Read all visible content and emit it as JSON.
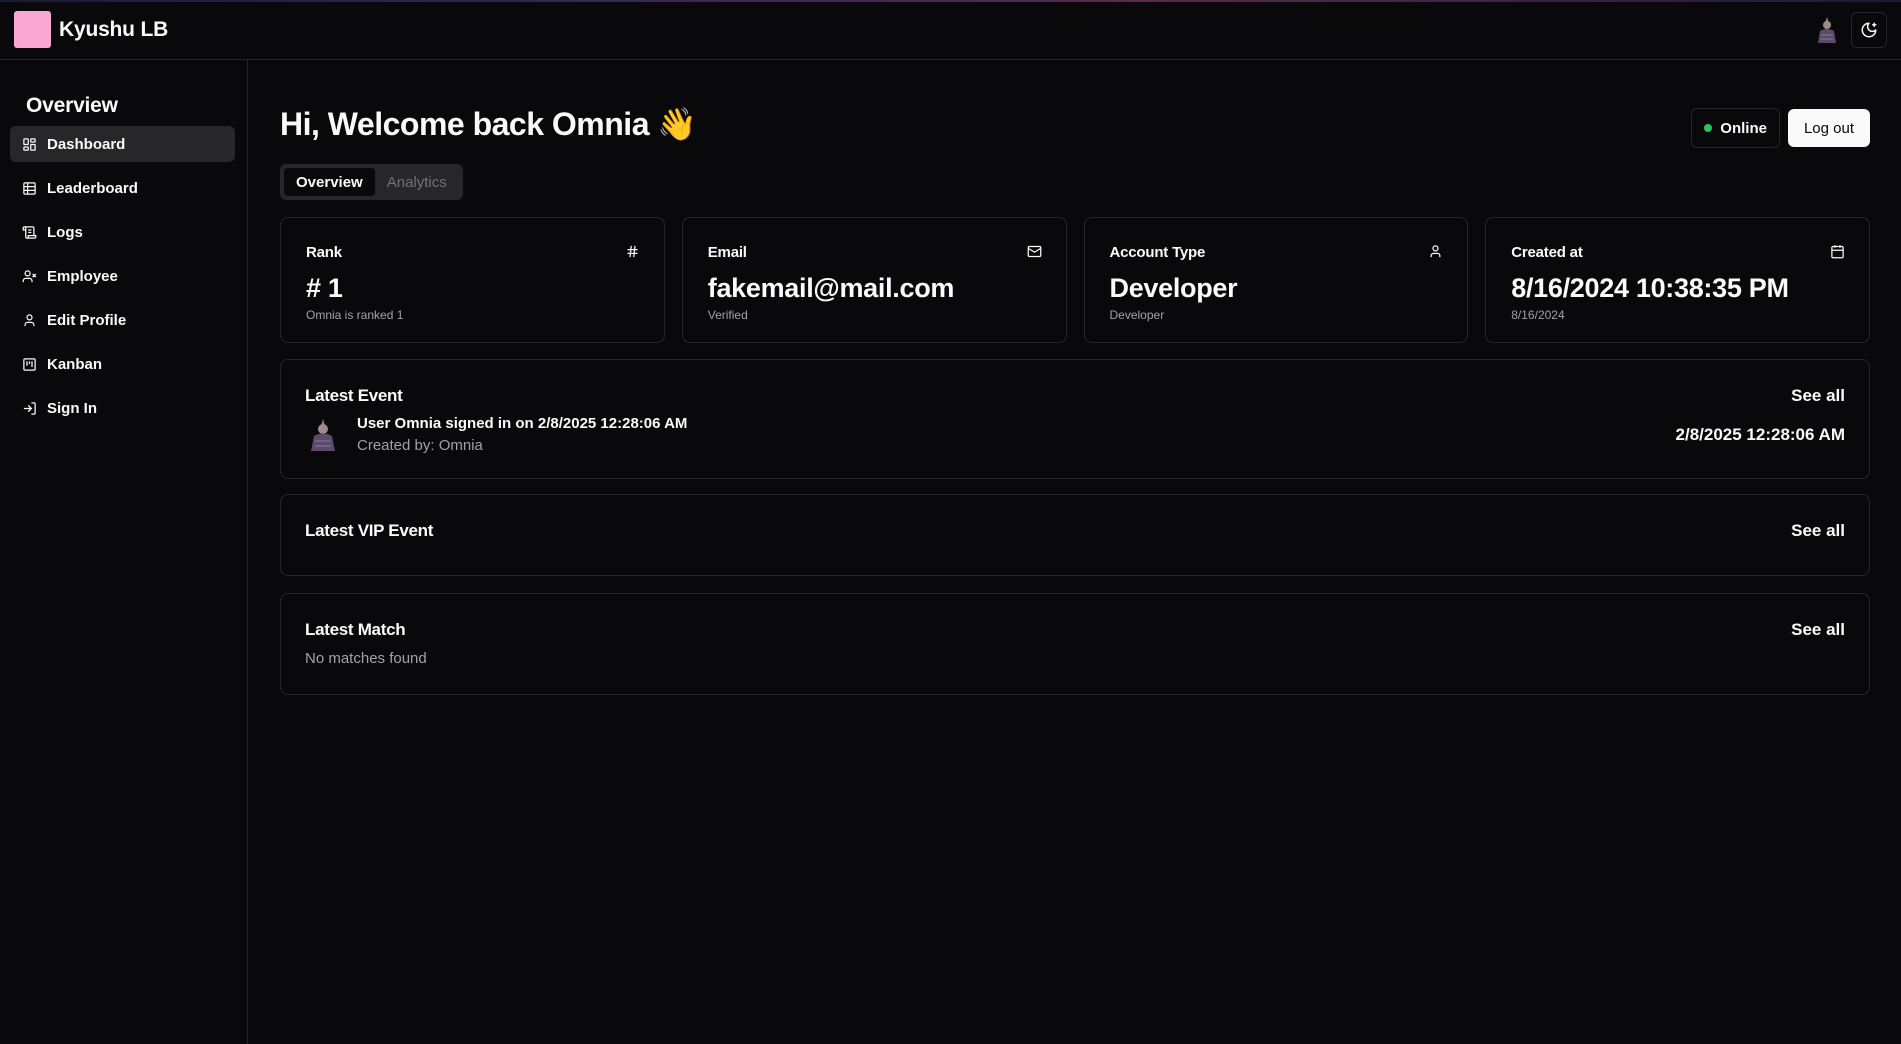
{
  "app": {
    "name": "Kyushu LB"
  },
  "colors": {
    "logo": "#f9a8d4",
    "online": "#22c55e",
    "background": "#09090b",
    "border": "#27272a"
  },
  "header": {
    "avatar_icon": "user-avatar-icon",
    "theme_icon": "moon-sun-icon"
  },
  "sidebar": {
    "title": "Overview",
    "items": [
      {
        "label": "Dashboard",
        "icon": "dashboard-icon",
        "active": true
      },
      {
        "label": "Leaderboard",
        "icon": "table-icon"
      },
      {
        "label": "Logs",
        "icon": "scroll-icon"
      },
      {
        "label": "Employee",
        "icon": "user-x-icon"
      },
      {
        "label": "Edit Profile",
        "icon": "user-icon"
      },
      {
        "label": "Kanban",
        "icon": "kanban-icon"
      },
      {
        "label": "Sign In",
        "icon": "login-icon"
      }
    ]
  },
  "main": {
    "greeting": "Hi, Welcome back Omnia 👋",
    "status": "Online",
    "logout_label": "Log out",
    "tabs": [
      {
        "label": "Overview",
        "active": true
      },
      {
        "label": "Analytics",
        "active": false
      }
    ],
    "cards": [
      {
        "label": "Rank",
        "value": "# 1",
        "sub": "Omnia is ranked 1",
        "icon": "hash-icon"
      },
      {
        "label": "Email",
        "value": "fakemail@mail.com",
        "sub": "Verified",
        "icon": "mail-icon"
      },
      {
        "label": "Account Type",
        "value": "Developer",
        "sub": "Developer",
        "icon": "user-icon"
      },
      {
        "label": "Created at",
        "value": "8/16/2024 10:38:35 PM",
        "sub": "8/16/2024",
        "icon": "calendar-icon"
      }
    ],
    "latest_event": {
      "title": "Latest Event",
      "see_all": "See all",
      "text": "User Omnia signed in on 2/8/2025 12:28:06 AM",
      "created_by": "Created by: Omnia",
      "time": "2/8/2025 12:28:06 AM"
    },
    "latest_vip_event": {
      "title": "Latest VIP Event",
      "see_all": "See all"
    },
    "latest_match": {
      "title": "Latest Match",
      "see_all": "See all",
      "empty": "No matches found"
    }
  }
}
